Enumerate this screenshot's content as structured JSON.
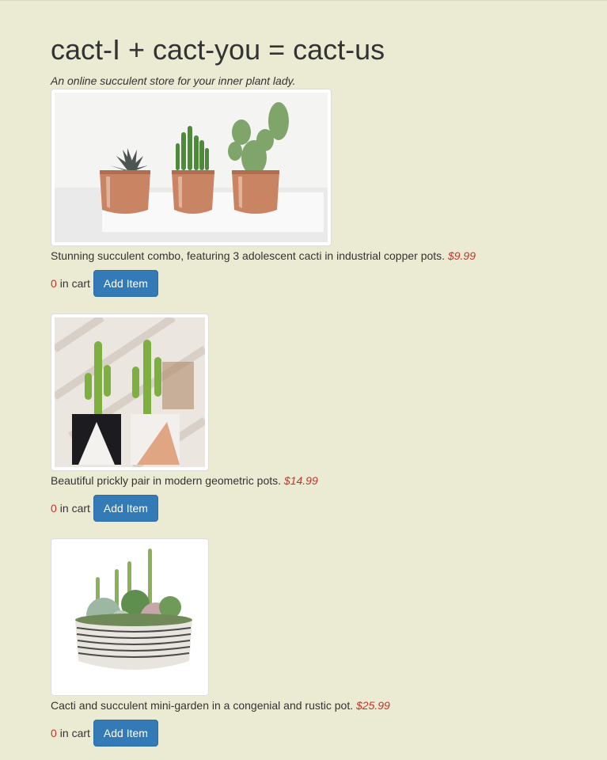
{
  "header": {
    "title": "cact-I + cact-you = cact-us",
    "tagline": "An online succulent store for your inner plant lady."
  },
  "products": [
    {
      "description": "Stunning succulent combo, featuring 3 adolescent cacti in industrial copper pots.",
      "price": "$9.99",
      "count": "0",
      "cart_label": "in cart",
      "button_label": "Add Item"
    },
    {
      "description": "Beautiful prickly pair in modern geometric pots.",
      "price": "$14.99",
      "count": "0",
      "cart_label": "in cart",
      "button_label": "Add Item"
    },
    {
      "description": "Cacti and succulent mini-garden in a congenial and rustic pot.",
      "price": "$25.99",
      "count": "0",
      "cart_label": "in cart",
      "button_label": "Add Item"
    }
  ],
  "colors": {
    "background": "#ebebd3",
    "price": "#c9302c",
    "button": "#337ab7"
  }
}
